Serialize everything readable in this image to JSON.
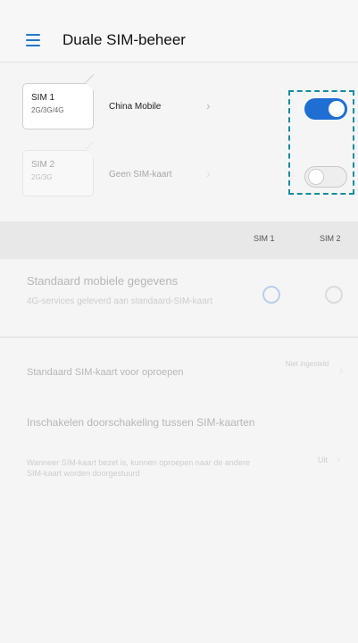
{
  "header": {
    "title": "Duale SIM-beheer"
  },
  "sims": [
    {
      "name": "SIM 1",
      "network": "2G/3G/4G",
      "carrier": "China Mobile",
      "enabled": true
    },
    {
      "name": "SIM 2",
      "network": "2G/3G",
      "carrier": "Geen SIM-kaart",
      "enabled": false
    }
  ],
  "columns": {
    "sim1": "SIM 1",
    "sim2": "SIM 2"
  },
  "default_data": {
    "title": "Standaard mobiele gegevens",
    "description": "4G-services geleverd aan standaard-SIM-kaart"
  },
  "default_calls": {
    "title": "Standaard SIM-kaart voor oproepen",
    "value": "Niet ingesteld"
  },
  "call_forwarding": {
    "title": "Inschakelen doorschakeling tussen SIM-kaarten",
    "description": "Wanneer SIM-kaart bezet is, kunnen oproepen naar de andere SIM-kaart worden doorgestuurd",
    "value": "Uit"
  },
  "colors": {
    "accent": "#1f6ed3",
    "highlight": "#138da0"
  }
}
